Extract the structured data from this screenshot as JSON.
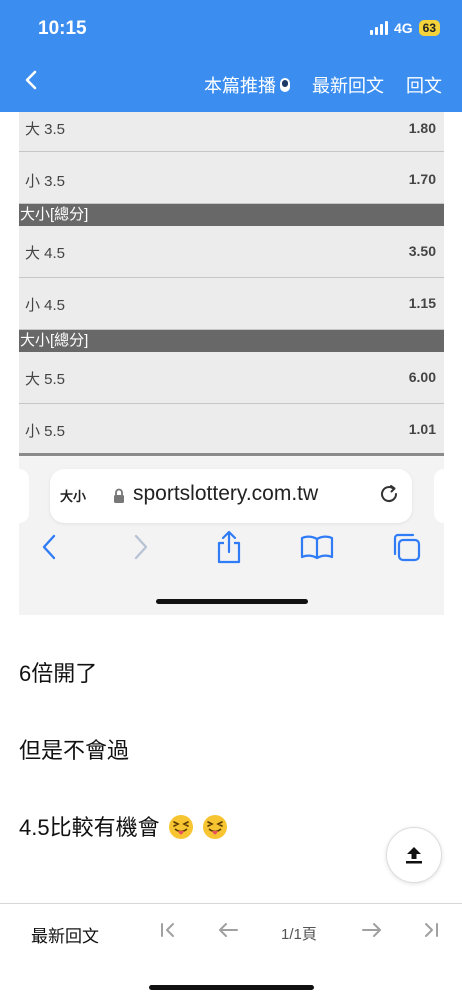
{
  "status": {
    "time": "10:15",
    "network": "4G",
    "battery": "63"
  },
  "nav": {
    "back_icon": "chevron-left-icon",
    "recommend_label": "本篇推播",
    "latest_label": "最新回文",
    "reply_label": "回文"
  },
  "embed": {
    "rows": [
      {
        "label": "大 3.5",
        "value": "1.80"
      },
      {
        "label": "小 3.5",
        "value": "1.70"
      },
      {
        "label": "大 4.5",
        "value": "3.50"
      },
      {
        "label": "小 4.5",
        "value": "1.15"
      },
      {
        "label": "大 5.5",
        "value": "6.00"
      },
      {
        "label": "小 5.5",
        "value": "1.01"
      }
    ],
    "group_headers": [
      "大小[總分]",
      "大小[總分]"
    ],
    "browser": {
      "text_size_label": "大小",
      "url": "sportslottery.com.tw"
    }
  },
  "post": {
    "lines": [
      "6倍開了",
      "但是不會過",
      "4.5比較有機會"
    ]
  },
  "bottom": {
    "latest_reply": "最新回文",
    "page_indicator": "1/1頁"
  },
  "colors": {
    "header_bg": "#3b8ef0",
    "group_header_bg": "#686868",
    "safari_icon": "#2f7cf6"
  }
}
